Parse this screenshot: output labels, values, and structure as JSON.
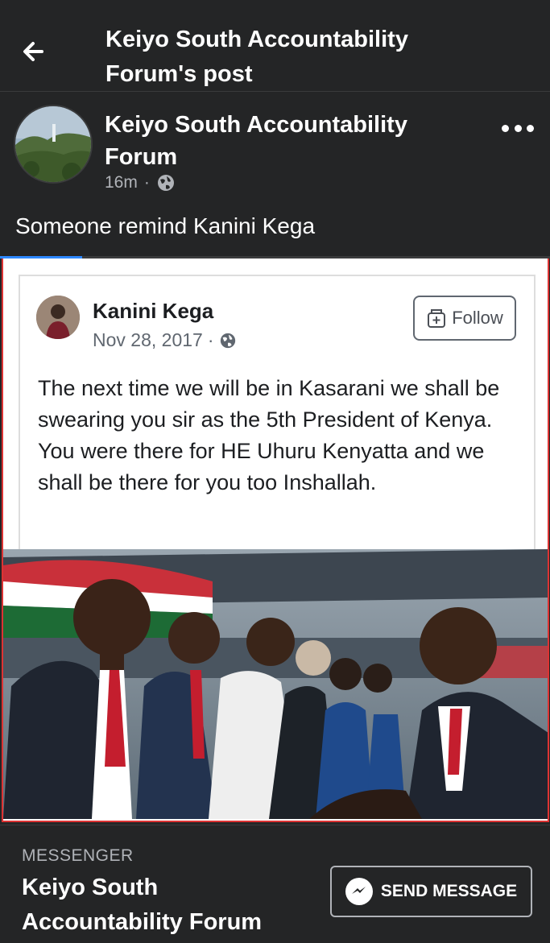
{
  "header": {
    "title": "Keiyo South Accountability Forum's post"
  },
  "post": {
    "page_name": "Keiyo South Accountability Forum",
    "time": "16m",
    "separator": "·",
    "caption": "Someone remind Kanini Kega",
    "video_progress": 0.15
  },
  "shared_card": {
    "author": "Kanini Kega",
    "date": "Nov 28, 2017",
    "separator": "·",
    "follow_label": "Follow",
    "text": "The next time we will be in Kasarani we shall be swearing you sir as the 5th President of Kenya. You were there for HE Uhuru Kenyatta and we shall be there for you too Inshallah."
  },
  "footer": {
    "label": "MESSENGER",
    "page_name": "Keiyo South Accountability Forum",
    "send_label": "SEND MESSAGE"
  },
  "colors": {
    "background": "#242526",
    "accent": "#2d88ff",
    "frame_border": "#dd3333"
  },
  "icons": {
    "back": "arrow-left-icon",
    "privacy": "globe-icon",
    "more": "more-horizontal-icon",
    "messenger": "messenger-icon",
    "follow": "follow-icon"
  }
}
